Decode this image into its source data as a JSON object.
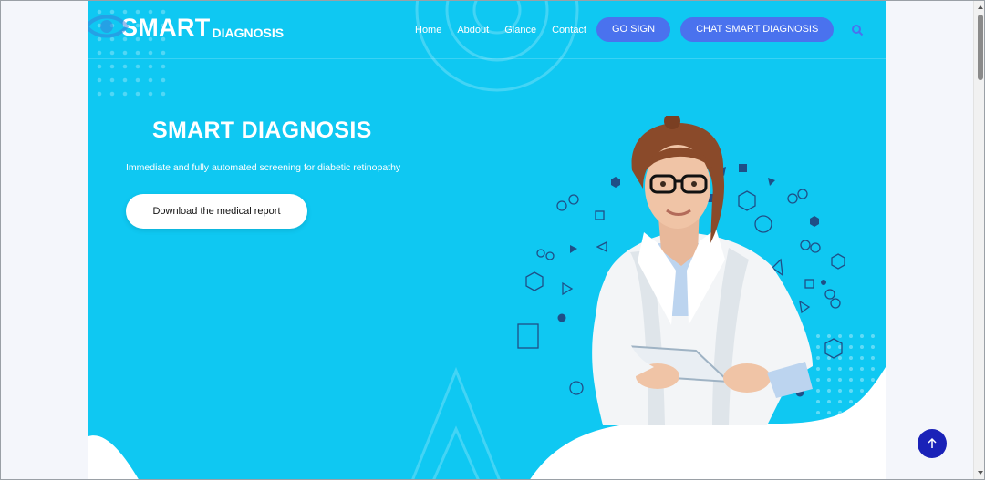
{
  "header": {
    "logo_main": "SMART",
    "logo_sub": "DIAGNOSIS",
    "nav": [
      "Home",
      "Abdout",
      "Glance",
      "Contact"
    ],
    "btn_sign": "GO SIGN",
    "btn_chat": "CHAT SMART DIAGNOSIS"
  },
  "hero": {
    "title": "SMART DIAGNOSIS",
    "subtitle": "Immediate and fully automated screening for diabetic retinopathy",
    "cta": "Download the medical report"
  },
  "colors": {
    "hero_bg": "#0fc8f2",
    "button": "#4a72ee",
    "scroll_top": "#1a22b8"
  }
}
